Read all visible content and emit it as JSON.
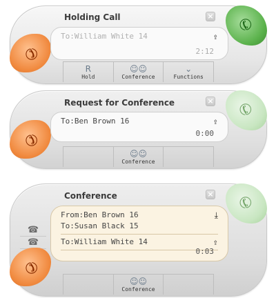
{
  "widget1": {
    "title": "Holding Call",
    "line1": "To:William White 14",
    "timer": "2:12",
    "buttons": [
      {
        "icon": "R",
        "label": "Hold"
      },
      {
        "icon": "conference-icon",
        "label": "Conference"
      },
      {
        "icon": "chevron-down-icon",
        "label": "Functions"
      }
    ]
  },
  "widget2": {
    "title": "Request for Conference",
    "line1": "To:Ben Brown 16",
    "timer": "0:00",
    "buttons": [
      {
        "icon": "",
        "label": ""
      },
      {
        "icon": "conference-icon",
        "label": "Conference"
      },
      {
        "icon": "",
        "label": ""
      }
    ]
  },
  "widget3": {
    "title": "Conference",
    "line_from": "From:Ben Brown 16",
    "line_to": "To:Susan Black 15",
    "line_to2": "To:William White 14",
    "timer": "0:03",
    "buttons": [
      {
        "icon": "",
        "label": ""
      },
      {
        "icon": "conference-icon",
        "label": "Conference"
      },
      {
        "icon": "",
        "label": ""
      }
    ]
  },
  "colors": {
    "accept_green": "#5bb24c",
    "hangup_orange": "#f0893e",
    "conference_bg": "#fbf3e2"
  }
}
